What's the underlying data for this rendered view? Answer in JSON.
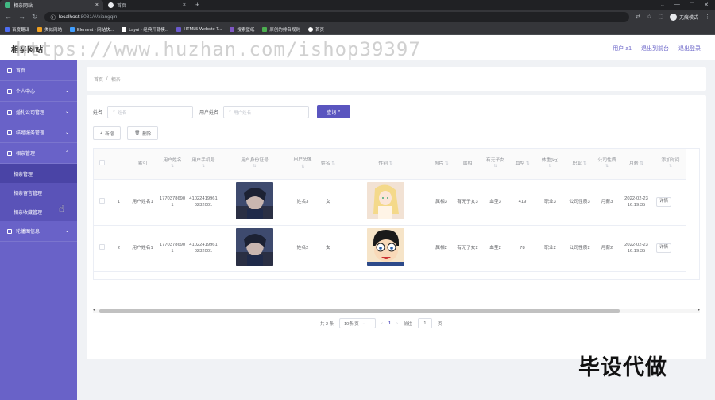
{
  "browser": {
    "tabs": [
      {
        "title": "相亲网站",
        "active": true,
        "favicon_color": "#41b883"
      },
      {
        "title": "首页",
        "active": false,
        "favicon_color": "#e8eaed"
      }
    ],
    "url_host": "localhost",
    "url_path": ":8081/#/xiangqin",
    "profile_label": "无痕模式",
    "bookmarks": [
      {
        "label": "百度翻译",
        "color": "#4e6ef2"
      },
      {
        "label": "类似网站",
        "color": "#f0a020"
      },
      {
        "label": "Element - 网站快...",
        "color": "#409eff"
      },
      {
        "label": "Layui - 经典开源模...",
        "color": "#ffffff"
      },
      {
        "label": "HTML5 Website T...",
        "color": "#6a5acd"
      },
      {
        "label": "搜索壁纸",
        "color": "#7e57c2"
      },
      {
        "label": "原创的排名规则",
        "color": "#4caf50"
      },
      {
        "label": "首页",
        "color": "#ffffff"
      }
    ]
  },
  "header": {
    "title": "相亲网站",
    "watermark": "https://www.huzhan.com/ishop39397",
    "links": [
      "用户 a1",
      "退出到前台",
      "退出登录"
    ]
  },
  "sidebar": {
    "items": [
      {
        "label": "首页",
        "has_children": false
      },
      {
        "label": "个人中心",
        "has_children": true
      },
      {
        "label": "婚礼公司管理",
        "has_children": true
      },
      {
        "label": "结婚服务管理",
        "has_children": true
      },
      {
        "label": "相亲管理",
        "has_children": true,
        "expanded": true
      }
    ],
    "submenu": [
      {
        "label": "相亲管理",
        "active": true
      },
      {
        "label": "相亲留言管理",
        "active": false
      },
      {
        "label": "相亲收藏管理",
        "active": false
      }
    ],
    "after": [
      {
        "label": "轮播图信息",
        "has_children": true
      }
    ]
  },
  "breadcrumb": {
    "home": "首页",
    "sep": "/",
    "current": "相亲"
  },
  "search": {
    "name_label": "姓名",
    "name_placeholder": "姓名",
    "user_label": "用户姓名",
    "user_placeholder": "用户姓名",
    "query_button": "查询"
  },
  "actions": {
    "add": "新增",
    "delete": "删除"
  },
  "table": {
    "columns": [
      "索引",
      "用户姓名",
      "用户手机号",
      "用户身份证号",
      "用户头像",
      "姓名",
      "性别",
      "照片",
      "属相",
      "有无子女",
      "血型",
      "体重(kg)",
      "职业",
      "公司性质",
      "月薪",
      "添加时间"
    ],
    "rows": [
      {
        "index": "1",
        "user_name": "用户姓名1",
        "phone": "17703786901",
        "id_card": "410224199610232001",
        "name": "姓名3",
        "gender": "女",
        "zodiac": "属相3",
        "children": "有无子女3",
        "blood": "血型3",
        "weight": "419",
        "job": "职业3",
        "company": "公司性质3",
        "salary": "月薪3",
        "added": "2022-02-23 16:19:35",
        "action": "详情"
      },
      {
        "index": "2",
        "user_name": "用户姓名1",
        "phone": "17703786901",
        "id_card": "410224199610232001",
        "name": "姓名2",
        "gender": "女",
        "zodiac": "属相2",
        "children": "有无子女2",
        "blood": "血型2",
        "weight": "78",
        "job": "职业2",
        "company": "公司性质2",
        "salary": "月薪2",
        "added": "2022-02-23 16:19:35",
        "action": "详情"
      }
    ]
  },
  "pagination": {
    "total": "共 2 条",
    "page_size": "10条/页",
    "current": "1",
    "goto_label": "前往",
    "goto_value": "1",
    "page_unit": "页"
  },
  "overlay_text": "毕设代做",
  "colors": {
    "sidebar": "#6962c8",
    "accent": "#5a55bf",
    "header_link": "#6a64c8"
  }
}
